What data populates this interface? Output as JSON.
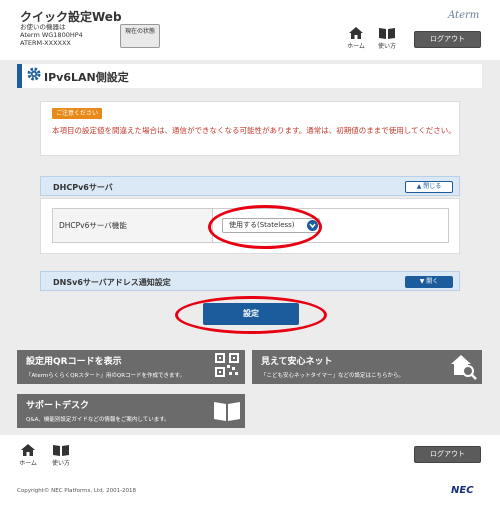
{
  "header": {
    "app_title": "クイック設定Web",
    "device_label": "お使いの機器は",
    "device_model": "Aterm WG1800HP4",
    "device_ssid": "ATERM-XXXXXX",
    "status_button_label": "現在の状態",
    "brand": "Aterm",
    "home_label": "ホーム",
    "help_label": "使い方",
    "logout_label": "ログアウト"
  },
  "page": {
    "title": "IPv6LAN側設定"
  },
  "notice": {
    "badge": "ご注意ください",
    "text": "本項目の設定値を間違えた場合は、通信ができなくなる可能性があります。通常は、初期値のままで使用してください。"
  },
  "dhcpv6": {
    "section_title": "DHCPv6サーバ",
    "toggle_label": "閉じる",
    "field_label": "DHCPv6サーバ機能",
    "field_value": "使用する(Stateless)"
  },
  "dnsv6": {
    "section_title": "DNSv6サーバアドレス通知設定",
    "toggle_label": "開く"
  },
  "submit_label": "設定",
  "tiles": [
    {
      "title": "設定用QRコードを表示",
      "desc": "「AtermらくらくQRスタート」用のQRコードを作成できます。",
      "icon": "qr-code-icon"
    },
    {
      "title": "見えて安心ネット",
      "desc": "「こども安心ネットタイマー」などの設定はこちらから。",
      "icon": "house-search-icon"
    },
    {
      "title": "サポートデスク",
      "desc": "Q&A、機能別設定ガイドなどの情報をご案内しています。",
      "icon": "book-icon"
    }
  ],
  "footer": {
    "home_label": "ホーム",
    "help_label": "使い方",
    "logout_label": "ログアウト",
    "copyright": "Copyright© NEC Platforms, Ltd. 2001-2018",
    "logo": "NEC"
  },
  "colors": {
    "accent": "#1c5c9c",
    "highlight": "#e60012",
    "warning": "#e88a1a"
  }
}
